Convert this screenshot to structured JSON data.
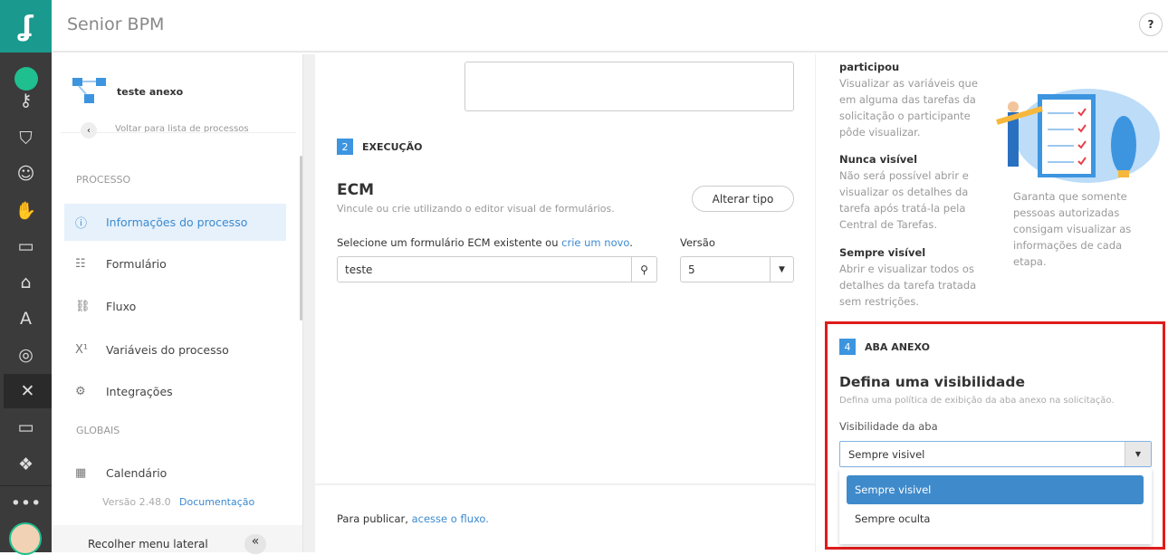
{
  "app": {
    "title": "Senior BPM",
    "help_icon": "?"
  },
  "rail": {
    "icons": [
      "chat-badge",
      "key",
      "shield",
      "team",
      "handshake",
      "briefcase",
      "backpack",
      "forklift",
      "target",
      "x-brand",
      "monitor",
      "cube",
      "more",
      "avatar"
    ],
    "more": "•••"
  },
  "sidebar": {
    "process_name": "teste anexo",
    "back_label": "Voltar para lista de processos",
    "section_process": "PROCESSO",
    "items": [
      {
        "label": "Informações do processo",
        "icon": "ⓘ"
      },
      {
        "label": "Formulário",
        "icon": "☷"
      },
      {
        "label": "Fluxo",
        "icon": "⛓"
      },
      {
        "label": "Variáveis do processo",
        "icon": "X¹"
      },
      {
        "label": "Integrações",
        "icon": "⚙"
      }
    ],
    "section_global": "GLOBAIS",
    "global_items": [
      {
        "label": "Calendário",
        "icon": "▦"
      }
    ],
    "version": "Versão 2.48.0",
    "docs_link": "Documentação",
    "collapse_label": "Recolher menu lateral",
    "collapse_icon": "«"
  },
  "execution": {
    "step": "2",
    "heading": "EXECUÇÃO",
    "type_title": "ECM",
    "type_desc": "Vincule ou crie utilizando o editor visual de formulários.",
    "change_type": "Alterar tipo",
    "form_label": "Selecione um formulário ECM existente ou ",
    "form_label_link": "crie um novo",
    "form_label_end": ".",
    "form_value": "teste",
    "version_label": "Versão",
    "version_value": "5"
  },
  "footer": {
    "text": "Para publicar, ",
    "link": "acesse o fluxo."
  },
  "visibility_info": {
    "partial_title": "participou",
    "partial_desc": "Visualizar as variáveis que em alguma das tarefas da solicitação o participante pôde visualizar.",
    "never_title": "Nunca visível",
    "never_desc": "Não será possível abrir e visualizar os detalhes da tarefa após tratá-la pela Central de Tarefas.",
    "always_title": "Sempre visível",
    "always_desc": "Abrir e visualizar todos os detalhes da tarefa tratada sem restrições.",
    "caption": "Garanta que somente pessoas autorizadas consigam visualizar as informações de cada etapa."
  },
  "attachment": {
    "step": "4",
    "heading": "ABA ANEXO",
    "title": "Defina uma visibilidade",
    "desc": "Defina uma política de exibição da aba anexo na solicitação.",
    "select_label": "Visibilidade da aba",
    "selected": "Sempre visivel",
    "options": [
      "Sempre visivel",
      "Sempre oculta"
    ]
  },
  "colors": {
    "accent": "#3d95e0",
    "teal": "#1a9a8f",
    "highlight": "#e01b1b"
  }
}
